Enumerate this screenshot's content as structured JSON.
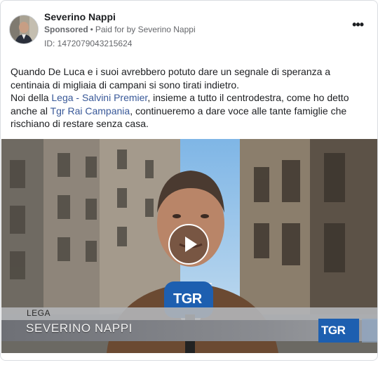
{
  "post": {
    "author": "Severino Nappi",
    "sponsored_label": "Sponsored",
    "separator": "•",
    "paid_for": "Paid for by Severino Nappi",
    "ad_id": "ID: 1472079043215624",
    "more_icon": "more-options-icon",
    "text": {
      "line1": "Quando De Luca e i suoi avrebbero potuto dare un segnale di speranza a centinaia di migliaia di campani si sono tirati indietro.",
      "line2_pre": "Noi della ",
      "line2_link1": "Lega - Salvini Premier",
      "line2_mid": ", insieme a tutto il centrodestra, come ho detto anche al ",
      "line2_link2": "Tgr Rai Campania",
      "line2_post": ", continueremo a dare voce alle tante famiglie che rischiano di restare senza casa."
    }
  },
  "video": {
    "lower_third_party": "LEGA",
    "lower_third_name": "SEVERINO NAPPI",
    "corner_logo": "TGR",
    "mic_logo": "TGR",
    "play_icon": "play-icon"
  },
  "colors": {
    "link": "#385898",
    "secondary_text": "#65676b",
    "lower_third_bar": "#7d7f84"
  }
}
